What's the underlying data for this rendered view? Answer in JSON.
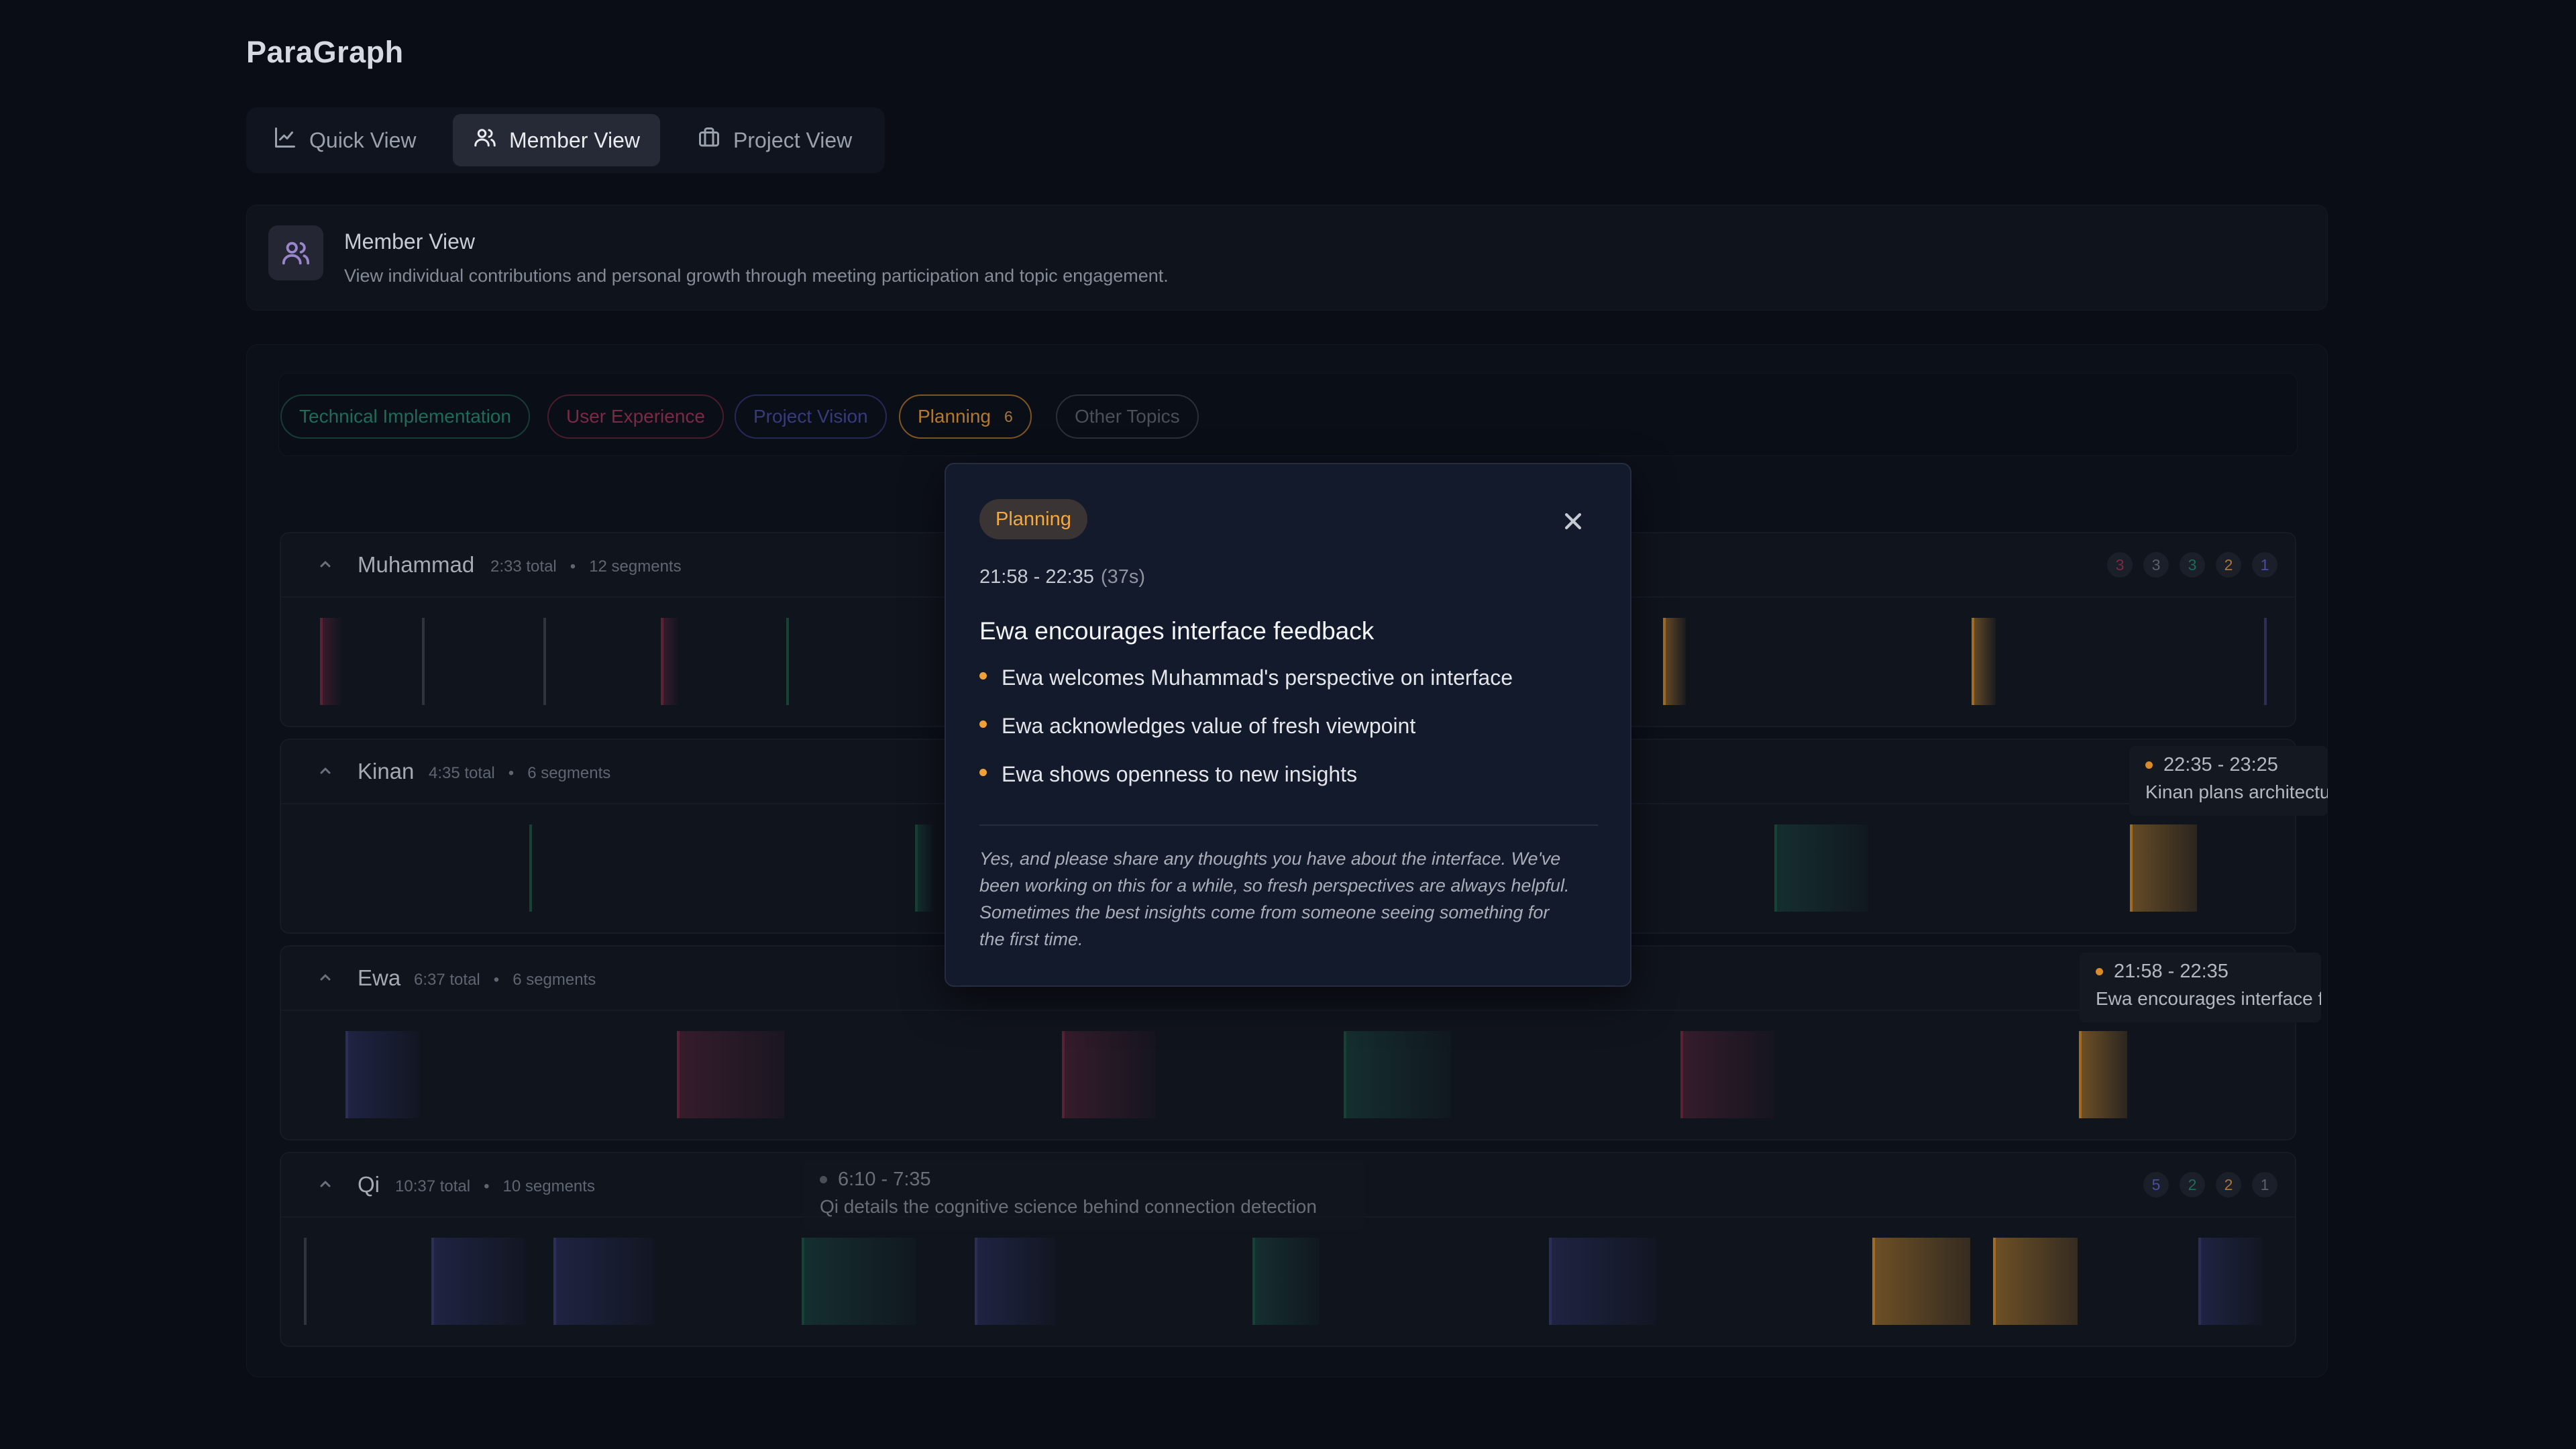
{
  "app": {
    "title": "ParaGraph"
  },
  "tabs": [
    {
      "label": "Quick View",
      "icon": "chart-line-icon",
      "active": false
    },
    {
      "label": "Member View",
      "icon": "users-icon",
      "active": true
    },
    {
      "label": "Project View",
      "icon": "briefcase-icon",
      "active": false
    }
  ],
  "info": {
    "title": "Member View",
    "description": "View individual contributions and personal growth through meeting participation and topic engagement.",
    "icon": "users-icon"
  },
  "topics": [
    {
      "label": "Technical Implementation",
      "color": "#1f6b57"
    },
    {
      "label": "User Experience",
      "color": "#7a2a45"
    },
    {
      "label": "Project Vision",
      "color": "#3a3a7a"
    },
    {
      "label": "Planning",
      "count": "6",
      "color": "#b27a2e",
      "active": true
    },
    {
      "label": "Other Topics",
      "color": "#4a4f5a"
    }
  ],
  "members": [
    {
      "name": "Muhammad",
      "total": "2:33 total",
      "segments": "12 segments",
      "badges": [
        "3",
        "3",
        "3",
        "2",
        "1"
      ]
    },
    {
      "name": "Kinan",
      "total": "4:35 total",
      "segments": "6 segments",
      "badges": []
    },
    {
      "name": "Ewa",
      "total": "6:37 total",
      "segments": "6 segments",
      "badges": []
    },
    {
      "name": "Qi",
      "total": "10:37 total",
      "segments": "10 segments",
      "badges": [
        "5",
        "2",
        "2",
        "1"
      ]
    }
  ],
  "stat_separator": "•",
  "tooltips": {
    "kinan": {
      "time": "22:35 - 23:25",
      "text": "Kinan plans architecture"
    },
    "ewa": {
      "time": "21:58 - 22:35",
      "text": "Ewa encourages interface feedback"
    },
    "qi": {
      "time": "6:10 - 7:35",
      "text": "Qi details the cognitive science behind connection detection"
    }
  },
  "modal": {
    "topic": "Planning",
    "time": "21:58 - 22:35",
    "duration": "(37s)",
    "title": "Ewa encourages interface feedback",
    "points": [
      "Ewa welcomes Muhammad's perspective on interface",
      "Ewa acknowledges value of fresh viewpoint",
      "Ewa shows openness to new insights"
    ],
    "quote": "Yes, and please share any thoughts you have about the interface. We've been working on this for a while, so fresh perspectives are always helpful. Sometimes the best insights come from someone seeing something for the first time."
  },
  "colors": {
    "tech": "#1f6b57",
    "ux": "#7a2a45",
    "vision": "#3d3f86",
    "planning": "#c88a2e",
    "other": "#3a3f4a"
  }
}
